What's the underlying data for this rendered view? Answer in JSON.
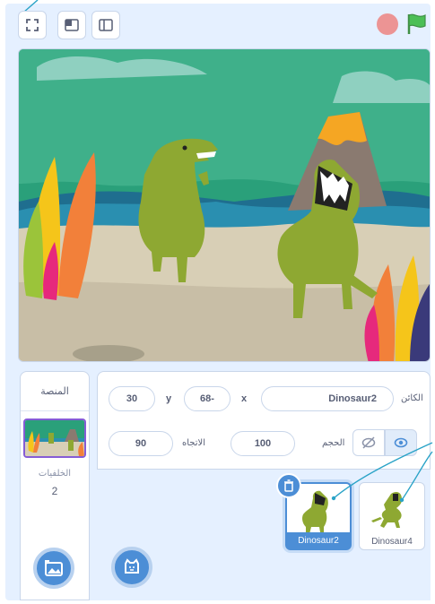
{
  "toolbar": {
    "fullscreen_icon": "fullscreen-icon",
    "small_stage_icon": "small-stage-icon",
    "normal_stage_icon": "normal-stage-icon",
    "stop_color": "#ec9494",
    "flag_color": "#4cbf56"
  },
  "stage_selector": {
    "header": "المنصة",
    "backdrops_label": "الخلفيات",
    "backdrops_count": "2"
  },
  "sprite_info": {
    "sprite_label": "الكائن",
    "sprite_name": "Dinosaur2",
    "x_label": "x",
    "x_value": "68-",
    "y_label": "y",
    "y_value": "30",
    "size_label": "الحجم",
    "size_value": "100",
    "direction_label": "الاتجاه",
    "direction_value": "90"
  },
  "sprites": [
    {
      "name": "Dinosaur2",
      "selected": true
    },
    {
      "name": "Dinosaur4",
      "selected": false
    }
  ],
  "colors": {
    "accent": "#4c8ed6",
    "panel_bg": "#e5f0ff",
    "border": "#c9d6ea"
  }
}
